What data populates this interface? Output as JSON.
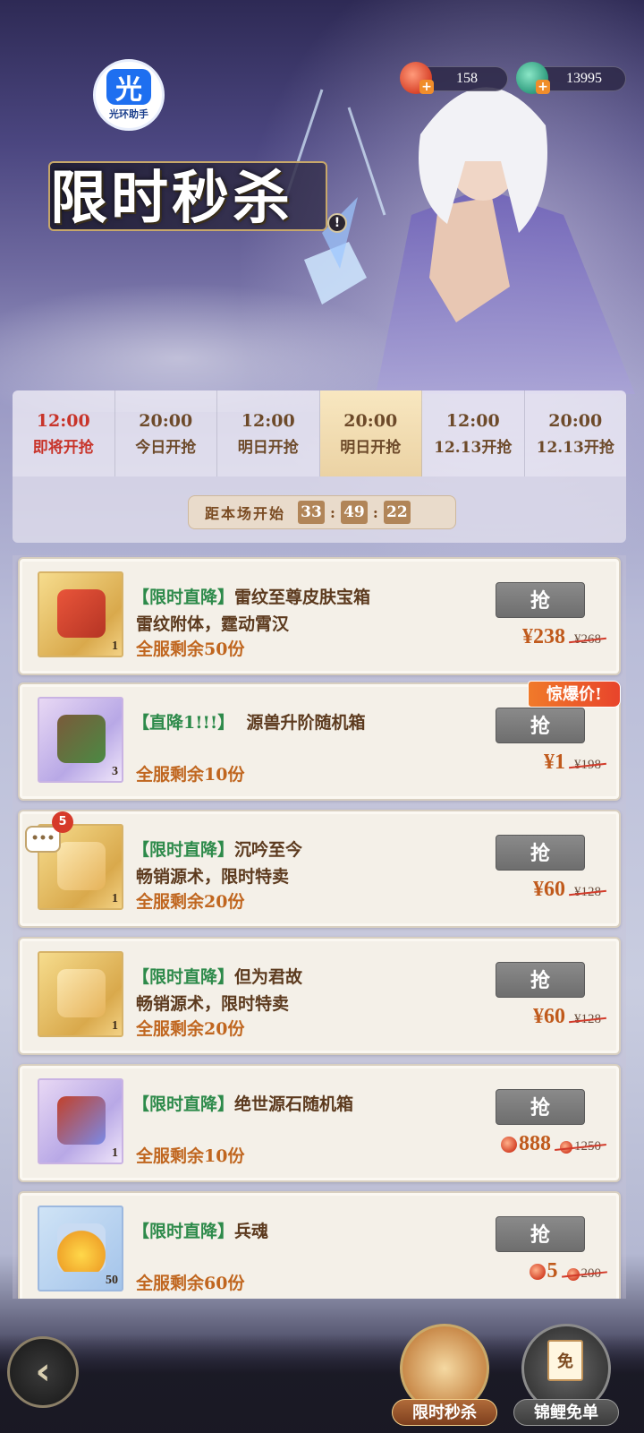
{
  "logo": {
    "mark": "光",
    "text": "光环助手"
  },
  "currencies": [
    {
      "icon": "red-gem-icon",
      "value": "158",
      "color": "#e4553a"
    },
    {
      "icon": "green-gem-icon",
      "value": "13995",
      "color": "#35a58a"
    }
  ],
  "title": "限时秒杀",
  "sessions": [
    {
      "time": "12:00",
      "status": "即将开抢",
      "highlight": "red"
    },
    {
      "time": "20:00",
      "status": "今日开抢"
    },
    {
      "time": "12:00",
      "status": "明日开抢"
    },
    {
      "time": "20:00",
      "status": "明日开抢",
      "active": true
    },
    {
      "time": "12:00",
      "status": "12.13开抢"
    },
    {
      "time": "20:00",
      "status": "12.13开抢"
    }
  ],
  "countdown": {
    "label": "距本场开始",
    "h": "33",
    "m": "49",
    "s": "22"
  },
  "items": [
    {
      "tag": "【限时直降】",
      "name": "雷纹至尊皮肤宝箱",
      "subtitle": "雷纹附体，霆动霄汉",
      "stock": "全服剩余50份",
      "qty": "1",
      "button": "抢",
      "price": "¥238",
      "old_price": "¥268"
    },
    {
      "tag": "【直降1!!!】",
      "name": "源兽升阶随机箱",
      "subtitle": "",
      "stock": "全服剩余10份",
      "qty": "3",
      "button": "抢",
      "price": "¥1",
      "old_price": "¥198"
    },
    {
      "tag": "【限时直降】",
      "name": "沉吟至今",
      "subtitle": "畅销源术，限时特卖",
      "stock": "全服剩余20份",
      "qty": "1",
      "button": "抢",
      "price": "¥60",
      "old_price": "¥128"
    },
    {
      "tag": "【限时直降】",
      "name": "但为君故",
      "subtitle": "畅销源术，限时特卖",
      "stock": "全服剩余20份",
      "qty": "1",
      "button": "抢",
      "price": "¥60",
      "old_price": "¥128"
    },
    {
      "tag": "【限时直降】",
      "name": "绝世源石随机箱",
      "subtitle": "",
      "stock": "全服剩余10份",
      "qty": "1",
      "button": "抢",
      "price": "888",
      "old_price": "1250"
    },
    {
      "tag": "【限时直降】",
      "name": "兵魂",
      "subtitle": "",
      "stock": "全服剩余60份",
      "qty": "50",
      "button": "抢",
      "price": "5",
      "old_price": "200"
    }
  ],
  "hot_badge": "惊爆价!",
  "chat": {
    "icon": "chat-bubble-icon",
    "count": "5",
    "dots": "•••"
  },
  "nav": {
    "back_icon": "back-arrow-icon",
    "flash_sale": "限时秒杀",
    "free_order": "锦鲤免单",
    "free_stamp": "免"
  }
}
